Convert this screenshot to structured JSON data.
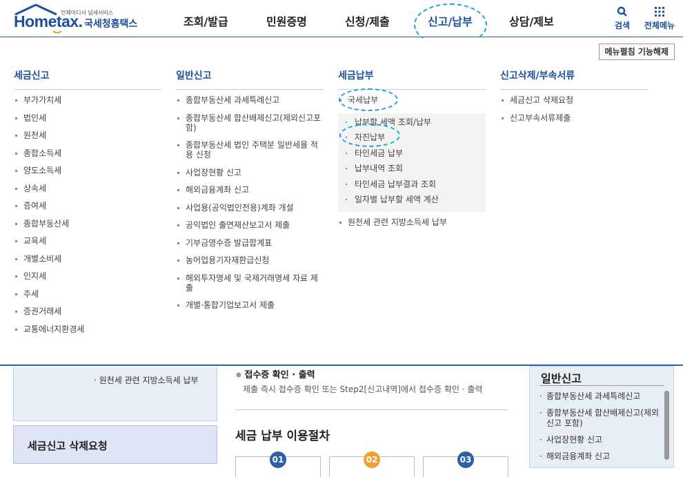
{
  "header": {
    "logo_small_text": "언제어디서 넘세서비스",
    "logo_home": "Home",
    "logo_tax": "tax.",
    "logo_korean": "국세청홈택스",
    "gnb": [
      "조회/발급",
      "민원증명",
      "신청/제출",
      "신고/납부",
      "상담/제보"
    ],
    "active_gnb": "신고/납부",
    "search_label": "검색",
    "allmenu_label": "전체메뉴",
    "accent_color": "#1c4fa0",
    "highlight_color": "#1aa0dc"
  },
  "mega_menu": {
    "fold_button": "메뉴펼침 기능해제",
    "columns": [
      {
        "title": "세금신고",
        "items": [
          "부가가치세",
          "법인세",
          "원천세",
          "종합소득세",
          "양도소득세",
          "상속세",
          "증여세",
          "종합부동산세",
          "교육세",
          "개별소비세",
          "인지세",
          "주세",
          "증권거래세",
          "교통에너지환경세"
        ]
      },
      {
        "title": "일반신고",
        "items": [
          "종합부동산세 과세특례신고",
          "종합부동산세 합산배제신고(제외신고포함)",
          "종합부동산세 법인 주택분 일반세율 적용 신청",
          "사업장현황 신고",
          "해외금융계좌 신고",
          "사업용(공익법인전용)계좌 개설",
          "공익법인 출연재산보고서 제출",
          "기부금영수증 발급합계표",
          "농어업용기자재환급신청",
          "해외투자명세 및 국제거래명세 자료 제출",
          "개별·통합기업보고서 제출"
        ]
      },
      {
        "title": "세금납부",
        "top_item": "국세납부",
        "sub_items": [
          "납부할 세액 조회/납부",
          "자진납부",
          "타인세금 납부",
          "납부내역 조회",
          "타인세금 납부결과 조회",
          "일자별 납부할 세액 계산"
        ],
        "after_item": "원천세 관련 지방소득세 납부"
      },
      {
        "title": "신고삭제/부속서류",
        "items": [
          "세금신고 삭제요청",
          "신고부속서류제출"
        ]
      }
    ]
  },
  "bottom": {
    "panel1_text": "· 원천세 관련 지방소득세 납부",
    "panel2_text": "세금신고 삭제요청",
    "receipt_title": "접수증 확인 · 출력",
    "receipt_desc": "제출 즉시 접수증 확인 또는 Step2[신고내역]에서 접수증 확인 · 출력",
    "procedure_title": "세금 납부 이용절차",
    "steps": [
      {
        "num": "01",
        "color": "#2d5fa6"
      },
      {
        "num": "02",
        "color": "#f0a030"
      },
      {
        "num": "03",
        "color": "#2d5fa6"
      }
    ],
    "right_title": "일반신고",
    "right_items": [
      "종합부동산세 과세특례신고",
      "종합부동산세 합산배제신고(제외신고 포함)",
      "사업장현황 신고",
      "해외금융계좌 신고"
    ]
  }
}
